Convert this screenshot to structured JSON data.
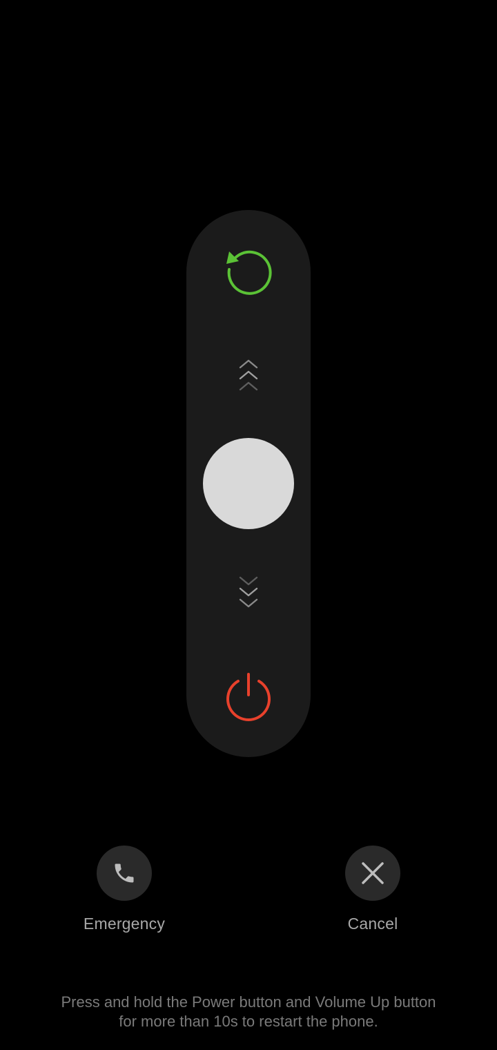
{
  "slider": {
    "restart_icon": "restart-icon",
    "power_icon": "power-off-icon",
    "up_icon": "chevrons-up-icon",
    "down_icon": "chevrons-down-icon",
    "restart_color": "#5bc236",
    "power_color": "#e8412c"
  },
  "actions": {
    "emergency": {
      "label": "Emergency",
      "icon": "phone-icon"
    },
    "cancel": {
      "label": "Cancel",
      "icon": "close-icon"
    }
  },
  "hint": {
    "line1": "Press and hold the Power button and Volume Up button",
    "line2": "for more than 10s to restart the phone."
  }
}
